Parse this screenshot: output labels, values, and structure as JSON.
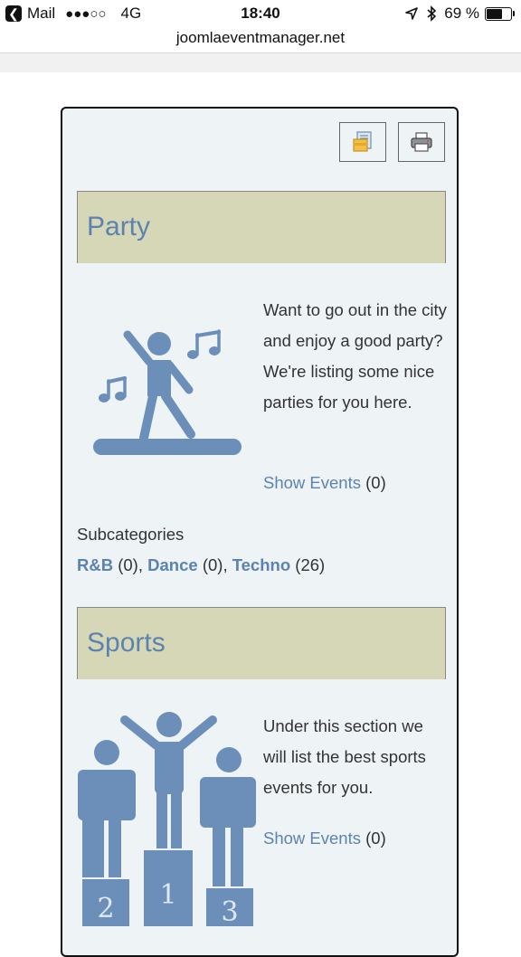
{
  "status_bar": {
    "carrier": "Mail",
    "signal": "●●●○○",
    "network": "4G",
    "time": "18:40",
    "battery": "69 %",
    "battery_level": 0.69
  },
  "browser": {
    "url": "joomlaeventmanager.net"
  },
  "toolbar": {
    "export_icon": "export-icon",
    "print_icon": "printer-icon"
  },
  "categories": [
    {
      "title": "Party",
      "description": "Want to go out in the city and enjoy a good party? We're listing some nice parties for you here.",
      "show_events_label": "Show Events",
      "count": "(0)",
      "image_icon": "dancer-icon",
      "subcategories_label": "Subcategories",
      "subcategories": [
        {
          "name": "R&B",
          "count": "(0)"
        },
        {
          "name": "Dance",
          "count": "(0)"
        },
        {
          "name": "Techno",
          "count": "(26)"
        }
      ]
    },
    {
      "title": "Sports",
      "description": "Under this section we will list the best sports events for you.",
      "show_events_label": "Show Events",
      "count": "(0)",
      "image_icon": "podium-icon",
      "podium_numbers": [
        "2",
        "1",
        "3"
      ]
    }
  ],
  "colors": {
    "link": "#5c83b0",
    "header_bg": "#d6d7b6",
    "panel_bg": "#eef3f6",
    "icon_blue": "#6b8fb9"
  }
}
